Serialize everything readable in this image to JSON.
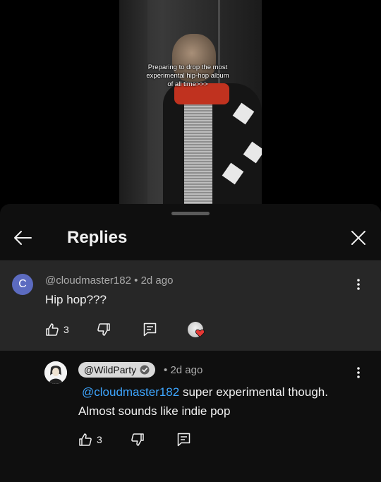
{
  "video": {
    "caption_lines": [
      "Preparing to drop the most",
      "experimental hip-hop album",
      "of all time>>>"
    ]
  },
  "sheet": {
    "title": "Replies"
  },
  "parent_comment": {
    "author": "@cloudmaster182",
    "avatar_letter": "C",
    "separator": "•",
    "time": "2d ago",
    "text": "Hip hop???",
    "likes": "3"
  },
  "reply_comment": {
    "author": "@WildParty",
    "separator": "•",
    "time": "2d ago",
    "mention": "@cloudmaster182",
    "text_after_mention": " super experimental though.",
    "text_line2": "Almost sounds like indie pop",
    "likes": "3"
  },
  "colors": {
    "accent_link": "#3ea6ff",
    "avatar_c": "#5c6bc0",
    "heart": "#e53935",
    "sheet_bg": "#0f0f0f",
    "highlight_bg": "#272727"
  }
}
